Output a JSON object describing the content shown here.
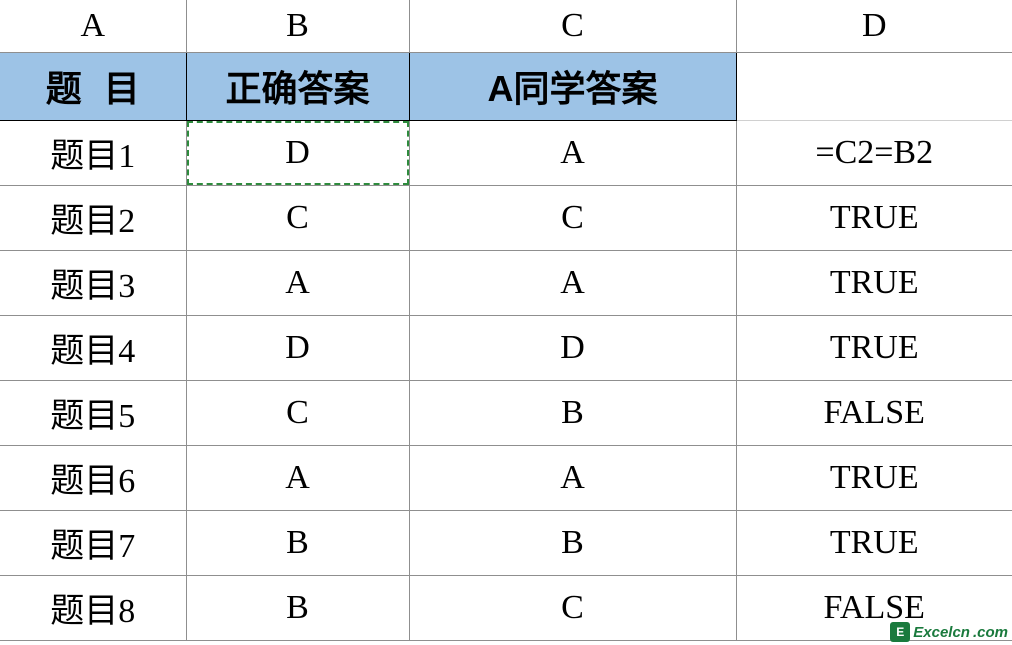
{
  "column_headers": [
    "A",
    "B",
    "C",
    "D"
  ],
  "table_headers": {
    "a": "题目",
    "b": "正确答案",
    "c": "A同学答案",
    "d": ""
  },
  "rows": [
    {
      "a": "题目1",
      "b": "D",
      "c": "A",
      "d": "=C2=B2"
    },
    {
      "a": "题目2",
      "b": "C",
      "c": "C",
      "d": "TRUE"
    },
    {
      "a": "题目3",
      "b": "A",
      "c": "A",
      "d": "TRUE"
    },
    {
      "a": "题目4",
      "b": "D",
      "c": "D",
      "d": "TRUE"
    },
    {
      "a": "题目5",
      "b": "C",
      "c": "B",
      "d": "FALSE"
    },
    {
      "a": "题目6",
      "b": "A",
      "c": "A",
      "d": "TRUE"
    },
    {
      "a": "题目7",
      "b": "B",
      "c": "B",
      "d": "TRUE"
    },
    {
      "a": "题目8",
      "b": "B",
      "c": "C",
      "d": "FALSE"
    }
  ],
  "watermark": {
    "icon": "E",
    "part1": "Excelcn",
    "part2": ".com"
  }
}
